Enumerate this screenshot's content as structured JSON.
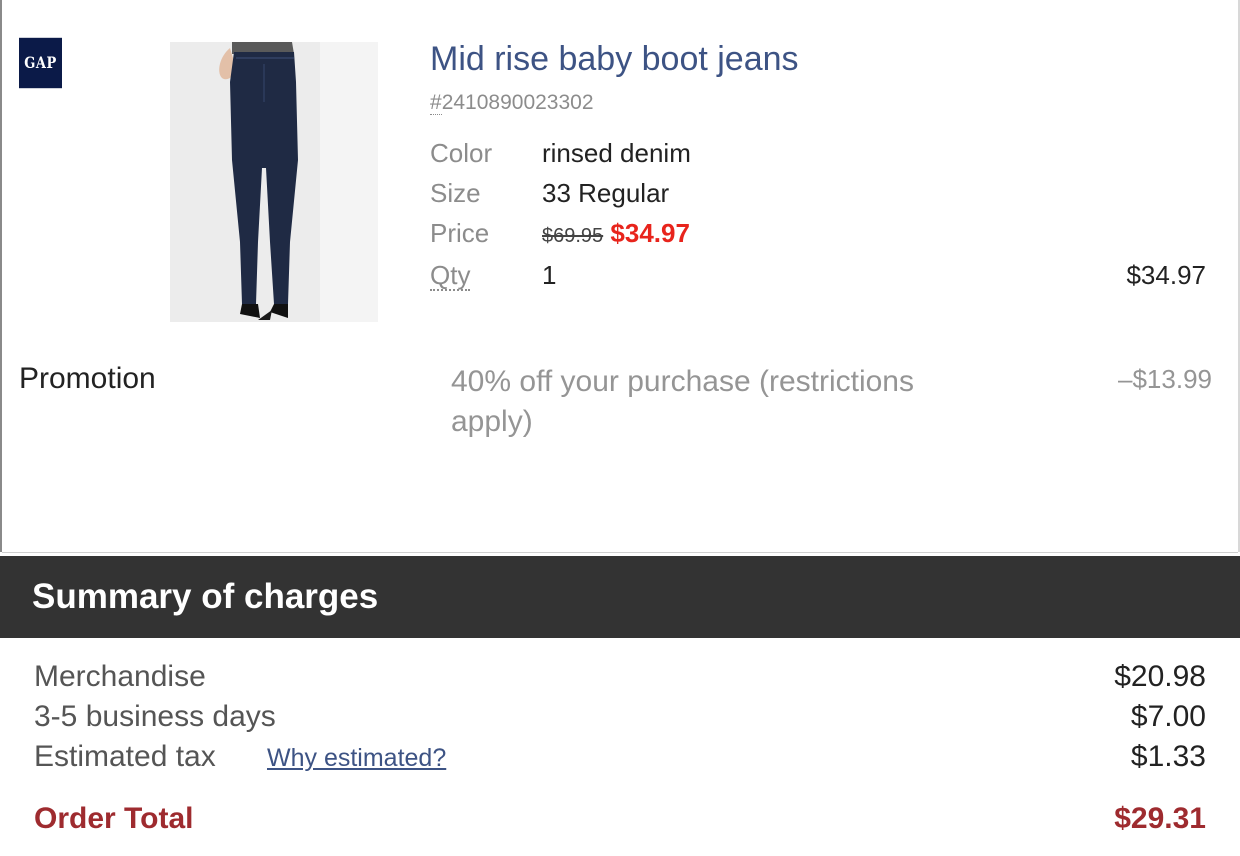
{
  "item": {
    "brand_logo_text": "GAP",
    "product_image_alt": "Mid rise baby boot jeans",
    "title": "Mid rise baby boot jeans",
    "sku_hash": "#",
    "sku_number": "2410890023302",
    "attributes": {
      "color_label": "Color",
      "color_value": "rinsed denim",
      "size_label": "Size",
      "size_value": "33 Regular",
      "price_label": "Price",
      "price_original": "$69.95",
      "price_sale": "$34.97",
      "qty_label": "Qty",
      "qty_value": "1"
    },
    "line_total": "$34.97"
  },
  "promotion": {
    "label": "Promotion",
    "description": "40% off your purchase (restrictions apply)",
    "amount": "–$13.99"
  },
  "summary": {
    "title": "Summary of charges",
    "merchandise_label": "Merchandise",
    "merchandise_value": "$20.98",
    "shipping_label": "3-5 business days",
    "shipping_value": "$7.00",
    "tax_label": "Estimated tax",
    "tax_link": "Why estimated?",
    "tax_value": "$1.33",
    "total_label": "Order Total",
    "total_value": "$29.31"
  },
  "colors": {
    "title_link": "#3d5384",
    "sale_price": "#e8241c",
    "order_total": "#9e2b2f",
    "header_bg": "#333333",
    "logo_bg": "#0b1a48"
  }
}
